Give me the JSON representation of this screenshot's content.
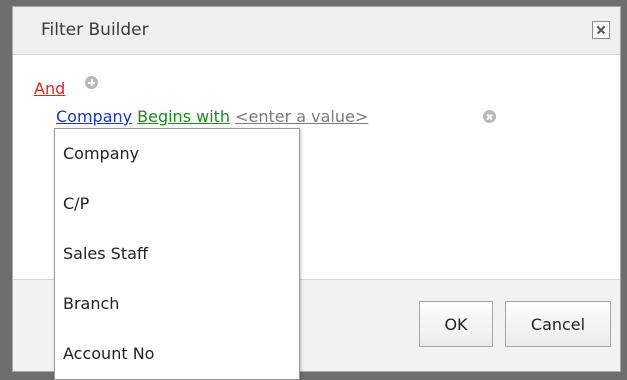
{
  "dialog": {
    "title": "Filter Builder",
    "close_icon": "close-icon"
  },
  "filter": {
    "group_operator": "And",
    "add_icon": "add-condition-icon",
    "condition": {
      "field": "Company",
      "operation": "Begins with",
      "value": "<enter a value>",
      "remove_icon": "remove-condition-icon"
    }
  },
  "field_dropdown": {
    "items": [
      "Company",
      "C/P",
      "Sales Staff",
      "Branch",
      "Account No"
    ]
  },
  "buttons": {
    "ok_label": "OK",
    "cancel_label": "Cancel"
  }
}
